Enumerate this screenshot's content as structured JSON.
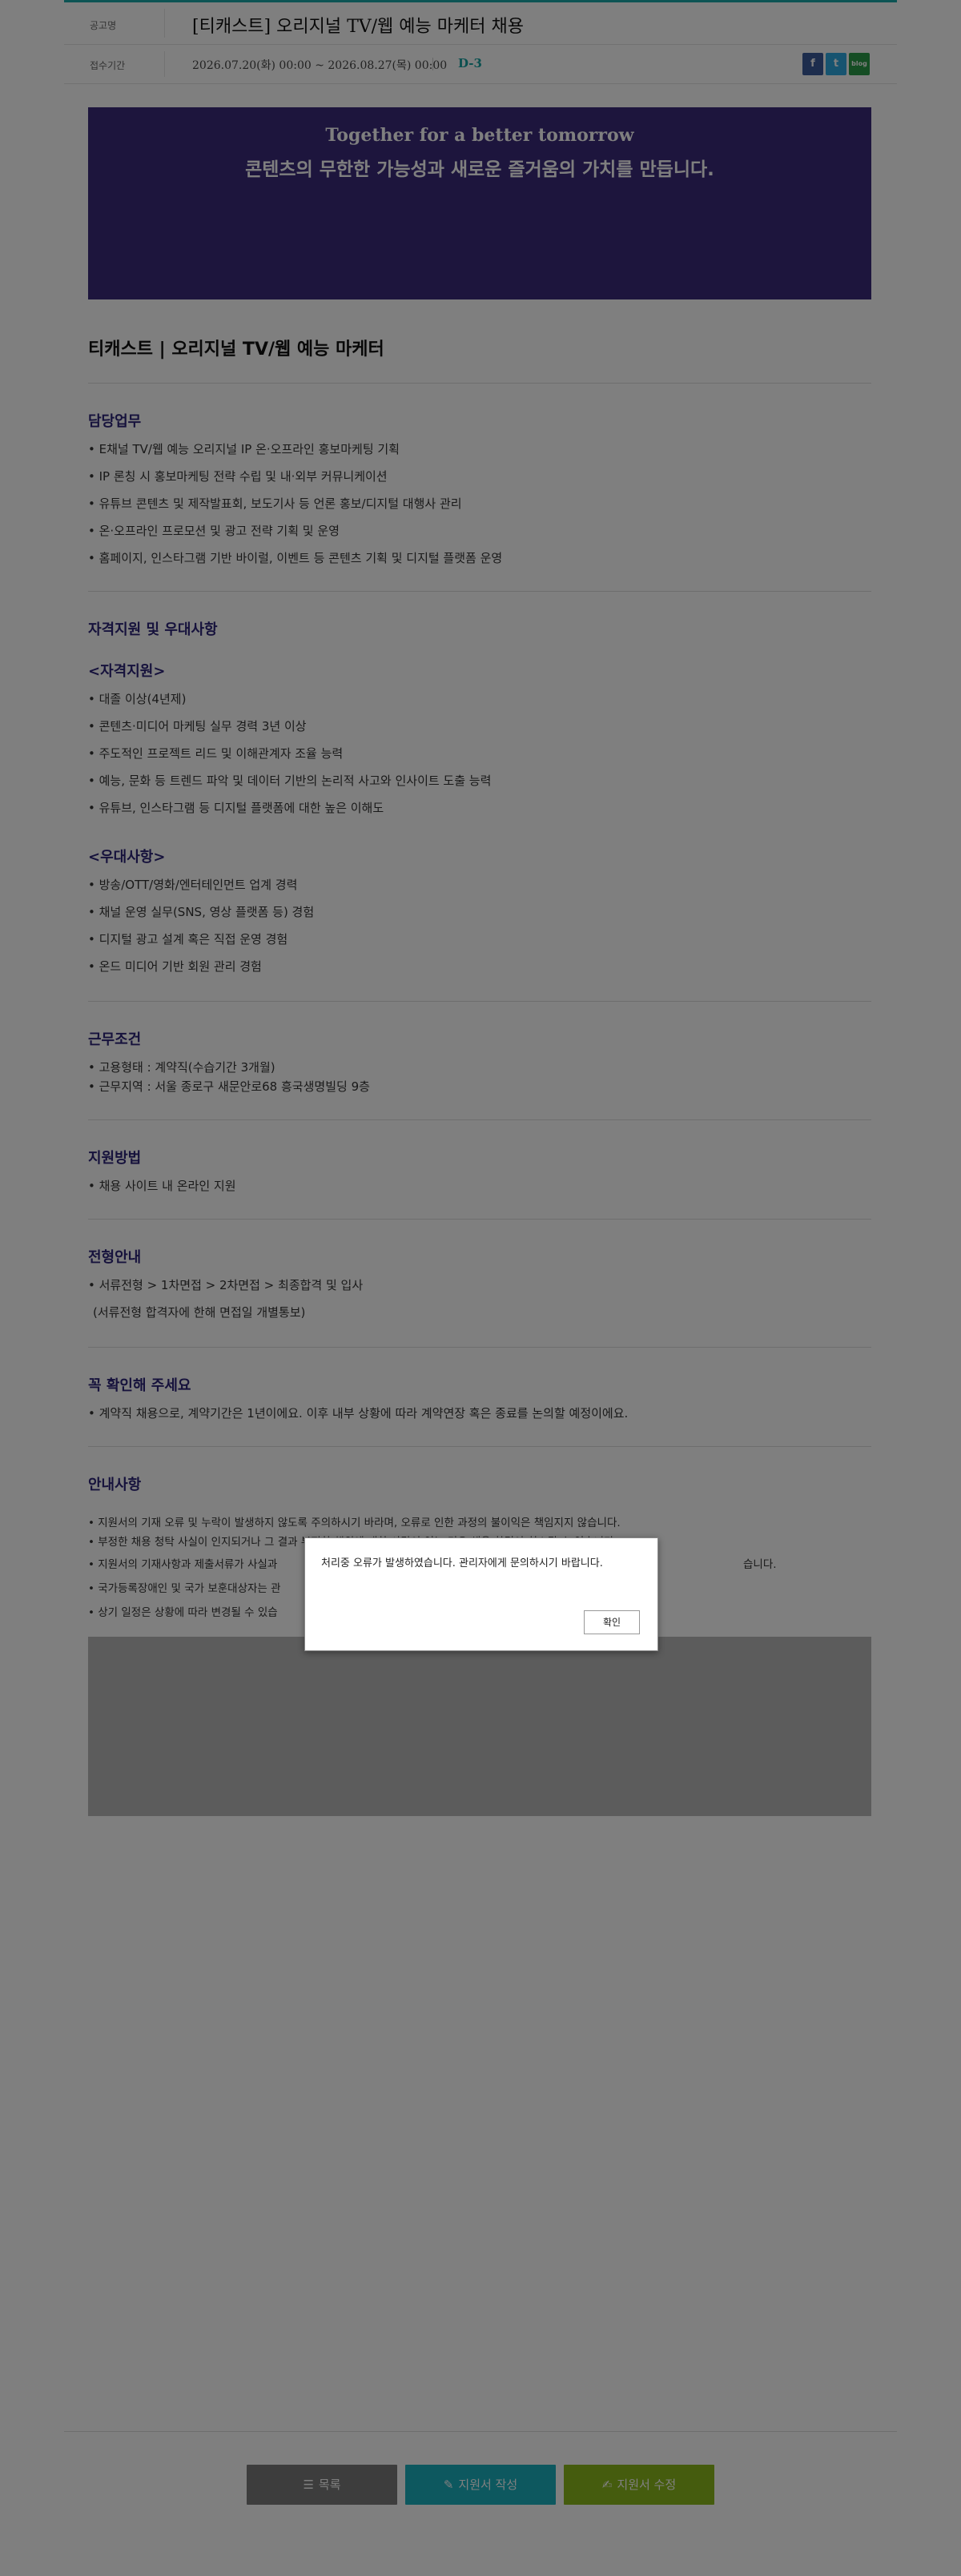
{
  "header": {
    "notice_label": "공고명",
    "title": "[티캐스트] 오리지널 TV/웹 예능 마케터 채용",
    "period_label": "접수기간",
    "period": "2026.07.20(화) 00:00 ~ 2026.08.27(목) 00:00",
    "dday": "D-3",
    "share_fb_icon": "facebook-icon",
    "share_tw_icon": "twitter-icon",
    "share_blog_icon": "blog-icon",
    "share_fb_text": "f",
    "share_tw_text": "t",
    "share_blog_text": "blog"
  },
  "banner": {
    "en": "Together for a better tomorrow",
    "ko": "콘텐츠의 무한한 가능성과 새로운 즐거움의 가치를 만듭니다."
  },
  "job_title": "티캐스트 | 오리지널 TV/웹 예능 마케터",
  "duties": {
    "heading": "담당업무",
    "items": [
      "• E채널 TV/웹 예능 오리지널 IP 온·오프라인 홍보마케팅 기획",
      "• IP 론칭 시 홍보마케팅 전략 수립 및 내·외부 커뮤니케이션",
      "• 유튜브 콘텐츠 및 제작발표회, 보도기사 등 언론 홍보/디지털 대행사 관리",
      "• 온·오프라인 프로모션 및 광고 전략 기획 및 운영",
      "• 홈페이지, 인스타그램 기반 바이럴, 이벤트 등 콘텐츠 기획 및 디지털 플랫폼 운영"
    ]
  },
  "qualifications": {
    "heading": "자격지원 및 우대사항",
    "req_heading": "<자격지원>",
    "req_items": [
      "• 대졸 이상(4년제)",
      "• 콘텐츠·미디어 마케팅 실무 경력 3년 이상",
      "• 주도적인 프로젝트 리드 및 이해관계자 조율 능력",
      "• 예능, 문화 등 트렌드 파악 및 데이터 기반의 논리적 사고와 인사이트 도출 능력",
      "• 유튜브, 인스타그램 등 디지털 플랫폼에 대한 높은 이해도"
    ],
    "pref_heading": "<우대사항>",
    "pref_items": [
      "• 방송/OTT/영화/엔터테인먼트 업계 경력",
      "• 채널 운영 실무(SNS, 영상 플랫폼 등) 경험",
      "• 디지털 광고 설계 혹은 직접 운영 경험",
      "• 온드 미디어 기반 회원 관리 경험"
    ]
  },
  "conditions": {
    "heading": "근무조건",
    "items": [
      "• 고용형태 : 계약직(수습기간 3개월)",
      "• 근무지역 : 서울 종로구 새문안로68 흥국생명빌딩 9층"
    ]
  },
  "apply": {
    "heading": "지원방법",
    "items": [
      "• 채용 사이트 내 온라인 지원"
    ]
  },
  "process": {
    "heading": "전형안내",
    "items": [
      "• 서류전형 > 1차면접 > 2차면접 > 최종합격 및 입사",
      "  (서류전형 합격자에 한해 면접일 개별통보)"
    ]
  },
  "check": {
    "heading": "꼭 확인해 주세요",
    "items": [
      "• 계약직 채용으로, 계약기간은 1년이에요. 이후 내부 상황에 따라 계약연장 혹은 종료를 논의할 예정이에요."
    ]
  },
  "notice": {
    "heading": "안내사항",
    "items": [
      "• 지원서의 기재 오류 및 누락이 발생하지 않도록 주의하시기 바라며, 오류로 인한 과정의 불이익은 책임지지 않습니다.",
      "• 부정한 채용 청탁 사실이 인지되거나 그 결과 부정한 행위에 대한 사람이 있는 경우 채용 합격이 취소될 수 있습니다.",
      "• 지원서의 기재사항과 제출서류가 사실과",
      "• 국가등록장애인 및 국가 보훈대상자는 관",
      "• 상기 일정은 상황에 따라 변경될 수 있습"
    ],
    "notice_item3_tail": "습니다."
  },
  "buttons": {
    "list": "목록",
    "write": "지원서 작성",
    "edit": "지원서 수정",
    "list_icon": "list-icon",
    "write_icon": "pencil-icon",
    "edit_icon": "edit-icon"
  },
  "dialog": {
    "message": "처리중 오류가 발생하였습니다. 관리자에게 문의하시기 바랍니다.",
    "ok": "확인"
  }
}
